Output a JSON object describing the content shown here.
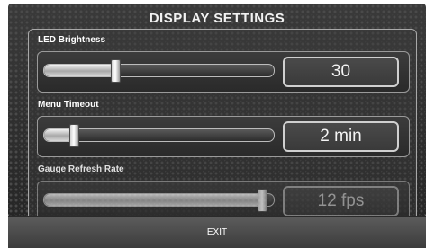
{
  "screen": {
    "title": "DISPLAY SETTINGS"
  },
  "settings": [
    {
      "label": "LED Brightness",
      "value": "30",
      "slider_fraction": 0.31
    },
    {
      "label": "Menu Timeout",
      "value": "2 min",
      "slider_fraction": 0.13
    },
    {
      "label": "Gauge Refresh Rate",
      "value": "12 fps",
      "slider_fraction": 0.95
    }
  ],
  "footer": {
    "exit_label": "EXIT"
  },
  "colors": {
    "screen_background": "#2c2c2c",
    "accent_border": "#d0d0d0",
    "text": "#ffffff"
  }
}
